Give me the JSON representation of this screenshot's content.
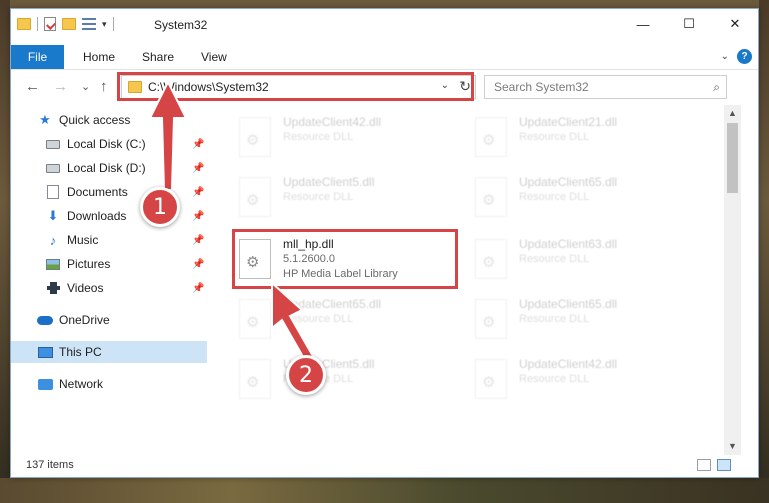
{
  "window": {
    "title": "System32"
  },
  "caption": {
    "minimize": "—",
    "maximize": "☐",
    "close": "✕"
  },
  "ribbon": {
    "file": "File",
    "home": "Home",
    "share": "Share",
    "view": "View",
    "help": "?"
  },
  "nav": {
    "back": "←",
    "forward": "→",
    "recent": "⌄",
    "up": "↑"
  },
  "address": {
    "path": "C:\\Windows\\System32",
    "dropdown": "⌄",
    "refresh": "↻"
  },
  "search": {
    "placeholder": "Search System32",
    "icon": "⌕"
  },
  "sidebar": {
    "items": [
      {
        "label": "Quick access"
      },
      {
        "label": "Local Disk (C:)"
      },
      {
        "label": "Local Disk (D:)"
      },
      {
        "label": "Documents"
      },
      {
        "label": "Downloads"
      },
      {
        "label": "Music"
      },
      {
        "label": "Pictures"
      },
      {
        "label": "Videos"
      },
      {
        "label": "OneDrive"
      },
      {
        "label": "This PC"
      },
      {
        "label": "Network"
      }
    ],
    "pin": "📌"
  },
  "files": [
    {
      "name": "UpdateClient42.dll",
      "desc": "Resource DLL"
    },
    {
      "name": "UpdateClient21.dll",
      "desc": "Resource DLL"
    },
    {
      "name": "UpdateClient5.dll",
      "desc": "Resource DLL"
    },
    {
      "name": "UpdateClient65.dll",
      "desc": "Resource DLL"
    },
    {
      "name": "mll_hp.dll",
      "version": "5.1.2600.0",
      "desc": "HP Media Label Library"
    },
    {
      "name": "UpdateClient63.dll",
      "desc": "Resource DLL"
    },
    {
      "name": "UpdateClient65.dll",
      "desc": "Resource DLL"
    },
    {
      "name": "UpdateClient65.dll",
      "desc": "Resource DLL"
    },
    {
      "name": "UpdateClient5.dll",
      "desc": "Resource DLL"
    },
    {
      "name": "UpdateClient42.dll",
      "desc": "Resource DLL"
    }
  ],
  "status": {
    "count": "137 items"
  },
  "annotations": {
    "badge1": "1",
    "badge2": "2",
    "color": "#d64545"
  }
}
